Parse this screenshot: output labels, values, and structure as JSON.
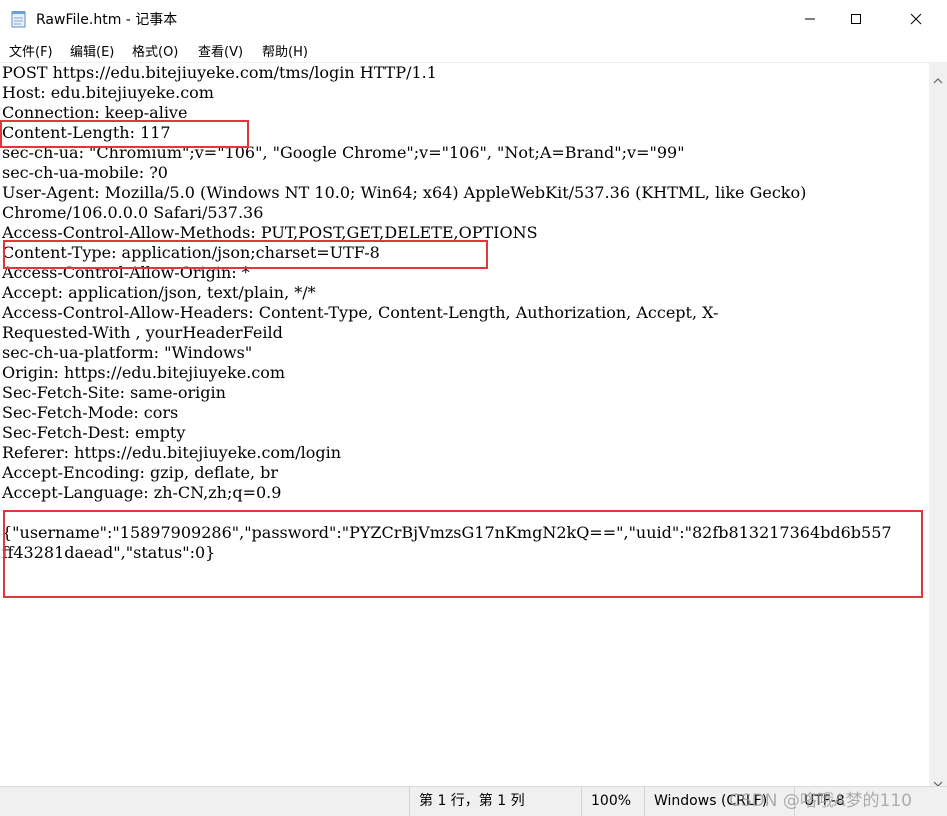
{
  "window": {
    "title": "RawFile.htm - 记事本",
    "icons": [
      "notepad-icon",
      "minimize-icon",
      "maximize-icon",
      "close-icon"
    ]
  },
  "menu": {
    "items": [
      "文件(F)",
      "编辑(E)",
      "格式(O)",
      "查看(V)",
      "帮助(H)"
    ]
  },
  "editor": {
    "lines": [
      "POST https://edu.bitejiuyeke.com/tms/login HTTP/1.1",
      "Host: edu.bitejiuyeke.com",
      "Connection: keep-alive",
      "Content-Length: 117",
      "sec-ch-ua: \"Chromium\";v=\"106\", \"Google Chrome\";v=\"106\", \"Not;A=Brand\";v=\"99\"",
      "sec-ch-ua-mobile: ?0",
      "User-Agent: Mozilla/5.0 (Windows NT 10.0; Win64; x64) AppleWebKit/537.36 (KHTML, like Gecko)",
      "Chrome/106.0.0.0 Safari/537.36",
      "Access-Control-Allow-Methods: PUT,POST,GET,DELETE,OPTIONS",
      "Content-Type: application/json;charset=UTF-8",
      "Access-Control-Allow-Origin: *",
      "Accept: application/json, text/plain, */*",
      "Access-Control-Allow-Headers: Content-Type, Content-Length, Authorization, Accept, X-",
      "Requested-With , yourHeaderFeild",
      "sec-ch-ua-platform: \"Windows\"",
      "Origin: https://edu.bitejiuyeke.com",
      "Sec-Fetch-Site: same-origin",
      "Sec-Fetch-Mode: cors",
      "Sec-Fetch-Dest: empty",
      "Referer: https://edu.bitejiuyeke.com/login",
      "Accept-Encoding: gzip, deflate, br",
      "Accept-Language: zh-CN,zh;q=0.9",
      "",
      "{\"username\":\"15897909286\",\"password\":\"PYZCrBjVmzsG17nKmgN2kQ==\",\"uuid\":\"82fb813217364bd6b557",
      "ff43281daead\",\"status\":0}"
    ],
    "highlight_color": "#e0373d"
  },
  "status": {
    "position": "第 1 行，第 1 列",
    "zoom": "100%",
    "line_ending": "Windows (CRLF)",
    "encoding": "UTF-8",
    "watermark": "CSDN @咯哦A梦的110"
  },
  "colors": {
    "statusbar_bg": "#f0f0f0",
    "text": "#000000"
  }
}
